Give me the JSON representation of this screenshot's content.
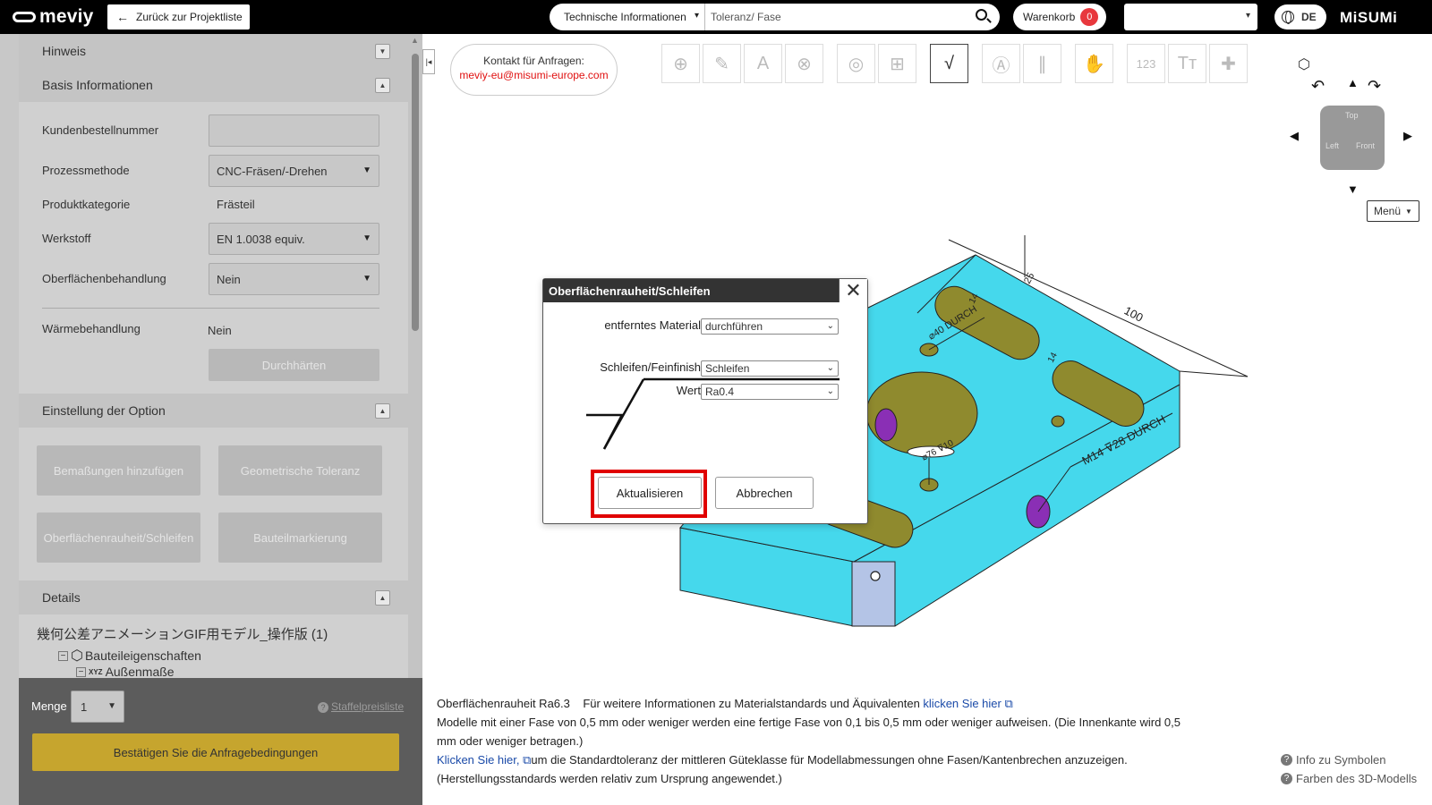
{
  "header": {
    "logo": "meviy",
    "back_button": "Zurück zur Projektliste",
    "search_category": "Technische Informationen",
    "search_placeholder": "Toleranz/ Fase",
    "cart_label": "Warenkorb",
    "cart_count": "0",
    "language": "DE",
    "brand": "MiSUMi"
  },
  "sidebar": {
    "sections": {
      "hinweis": "Hinweis",
      "basis": "Basis Informationen",
      "option": "Einstellung der Option",
      "details": "Details"
    },
    "fields": {
      "kundenbestellnummer_label": "Kundenbestellnummer",
      "kundenbestellnummer_value": "",
      "prozess_label": "Prozessmethode",
      "prozess_value": "CNC-Fräsen/-Drehen",
      "kategorie_label": "Produktkategorie",
      "kategorie_value": "Frästeil",
      "werkstoff_label": "Werkstoff",
      "werkstoff_value": "EN 1.0038 equiv.",
      "oberflaeche_label": "Oberflächenbehandlung",
      "oberflaeche_value": "Nein",
      "waerme_label": "Wärmebehandlung",
      "waerme_value": "Nein",
      "durchhaerten": "Durchhärten"
    },
    "options": {
      "bemassungen": "Bemaßungen hinzufügen",
      "toleranz": "Geometrische Toleranz",
      "rauheit": "Oberflächenrauheit/Schleifen",
      "markierung": "Bauteilmarkierung"
    },
    "tree": {
      "root": "幾何公差アニメーションGIF用モデル_操作版 (1)",
      "props": "Bauteileigenschaften",
      "dims": "Außenmaße"
    },
    "bottom": {
      "menge_label": "Menge",
      "menge_value": "1",
      "staffel": "Staffelpreisliste",
      "confirm": "Bestätigen Sie die Anfragebedingungen"
    }
  },
  "contact": {
    "line1": "Kontakt für Anfragen:",
    "line2": "meviy-eu@misumi-europe.com"
  },
  "viewcube": {
    "top": "Top",
    "left": "Left",
    "front": "Front",
    "menu": "Menü"
  },
  "model": {
    "dim_100": "100",
    "dim_25": "25",
    "slot_label": "⌀40 DURCH",
    "thread_label": "M14 ⊽28 DURCH",
    "hole_label": "⌀76 ⊽10",
    "dim_14a": "14",
    "dim_14b": "14"
  },
  "dialog": {
    "title": "Oberflächenrauheit/Schleifen",
    "material_label": "entferntes Material",
    "material_value": "durchführen",
    "finish_label": "Schleifen/Feinfinish",
    "finish_value": "Schleifen",
    "wert_label": "Wert",
    "wert_value": "Ra0.4",
    "update": "Aktualisieren",
    "cancel": "Abbrechen"
  },
  "info": {
    "line1_prefix": "Oberflächenrauheit Ra6.3    Für weitere Informationen zu Materialstandards und Äquivalenten ",
    "line1_link": "klicken Sie hier",
    "line2": "Modelle mit einer Fase von 0,5 mm oder weniger werden eine fertige Fase von 0,1 bis 0,5 mm oder weniger aufweisen. (Die Innenkante wird 0,5",
    "line3": "mm oder weniger betragen.)",
    "line4_link": "Klicken Sie hier,",
    "line4_rest": "um die Standardtoleranz der mittleren Güteklasse für Modellabmessungen ohne Fasen/Kantenbrechen anzuzeigen.",
    "line5": "(Herstellungsstandards werden relativ zum Ursprung angewendet.)",
    "help1": "Info zu Symbolen",
    "help2": "Farben des 3D-Modells"
  },
  "colors": {
    "model": "#45d8ec",
    "hole": "#8f8a2e",
    "purple": "#8a2fb5",
    "highlight": "#e00000",
    "confirm": "#c6a52e"
  }
}
